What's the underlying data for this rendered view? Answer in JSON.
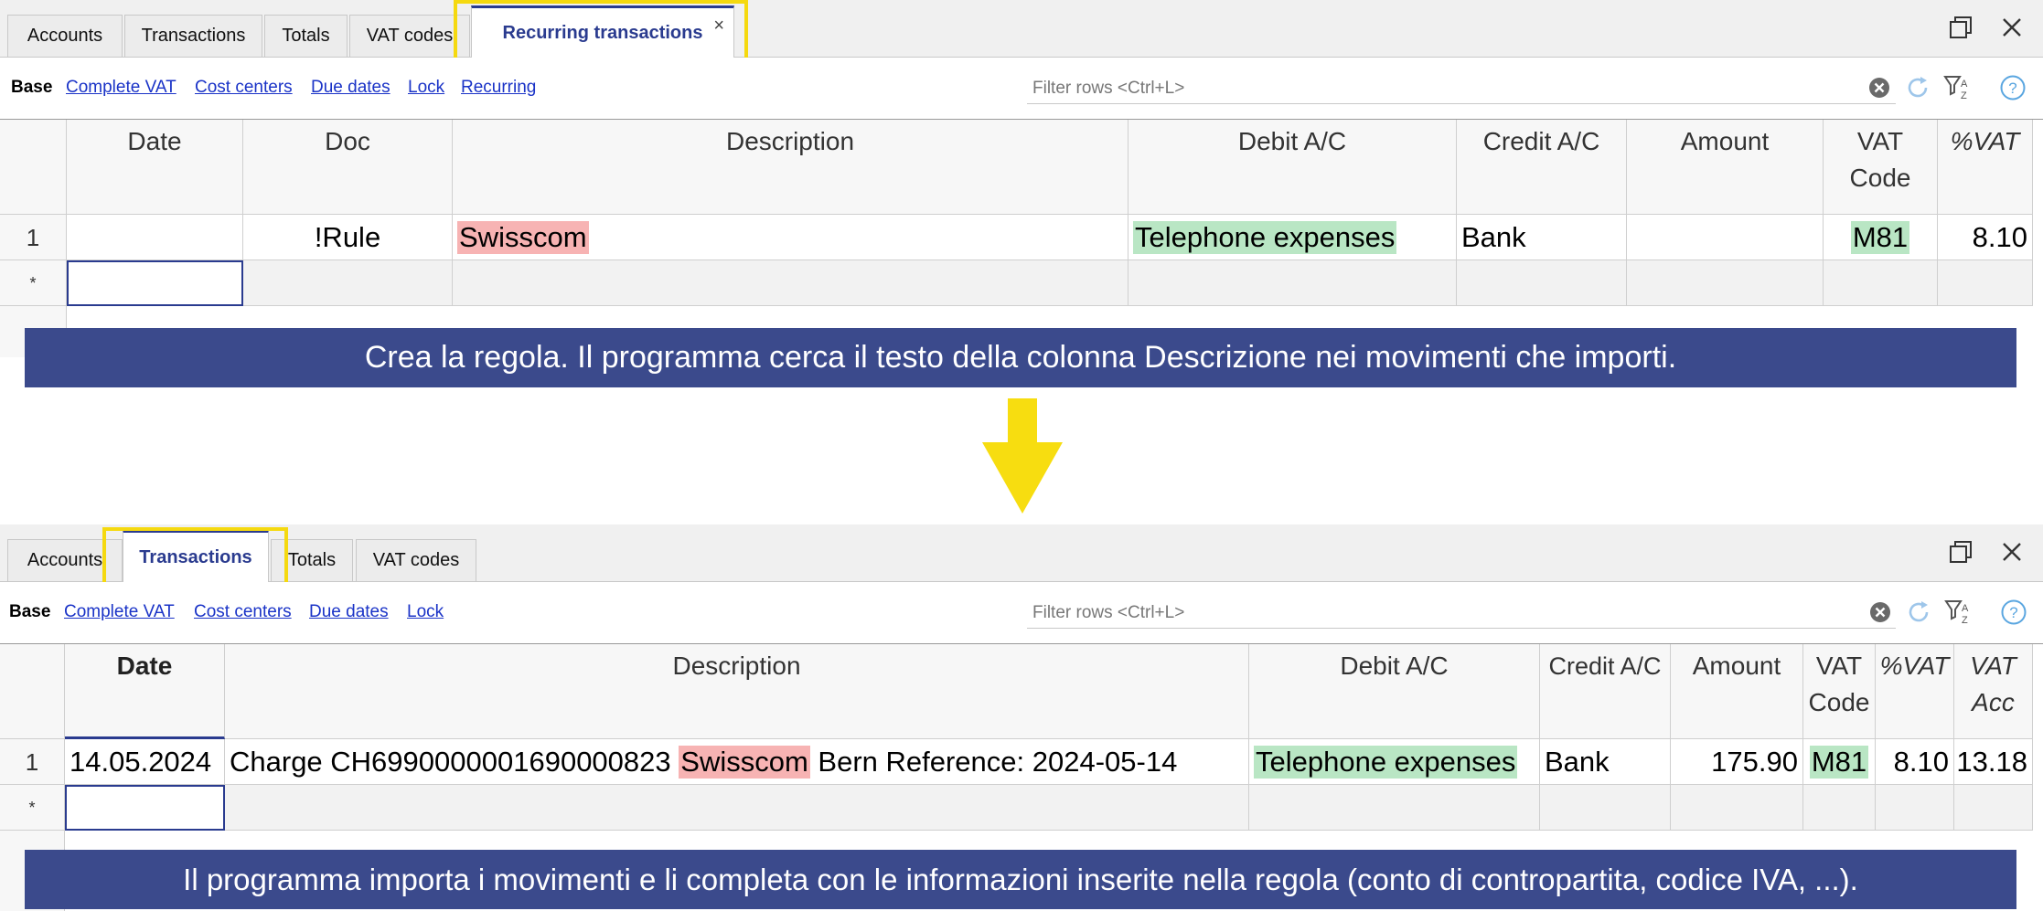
{
  "top": {
    "tabs": [
      "Accounts",
      "Transactions",
      "Totals",
      "VAT codes"
    ],
    "active_tab": "Recurring transactions",
    "tab_close_glyph": "×",
    "views": [
      "Base",
      "Complete VAT",
      "Cost centers",
      "Due dates",
      "Lock",
      "Recurring"
    ],
    "filter_placeholder": "Filter rows <Ctrl+L>",
    "columns": [
      "Date",
      "Doc",
      "Description",
      "Debit A/C",
      "Credit A/C",
      "Amount",
      "VAT Code",
      "%VAT"
    ],
    "row": {
      "num": "1",
      "date": "",
      "doc": "!Rule",
      "description": "Swisscom",
      "debit": "Telephone expenses",
      "credit": "Bank",
      "amount": "",
      "vat_code": "M81",
      "vat_pct": "8.10"
    },
    "new_row_marker": "*"
  },
  "caption_top": "Crea la regola. Il programma cerca il testo della colonna Descrizione nei movimenti che importi.",
  "bottom": {
    "tabs": [
      "Accounts",
      "Totals",
      "VAT codes"
    ],
    "active_tab": "Transactions",
    "views": [
      "Base",
      "Complete VAT",
      "Cost centers",
      "Due dates",
      "Lock"
    ],
    "filter_placeholder": "Filter rows <Ctrl+L>",
    "columns": [
      "Date",
      "Description",
      "Debit A/C",
      "Credit A/C",
      "Amount",
      "VAT Code",
      "%VAT",
      "VAT Acc"
    ],
    "row": {
      "num": "1",
      "date": "14.05.2024",
      "desc_pre": "Charge CH6990000001690000823",
      "desc_hl": "Swisscom",
      "desc_post": "Bern Reference: 2024-05-14",
      "debit": "Telephone expenses",
      "credit": "Bank",
      "amount": "175.90",
      "vat_code": "M81",
      "vat_pct": "8.10",
      "vat_acc": "13.18"
    },
    "new_row_marker": "*"
  },
  "caption_bottom": "Il programma importa i movimenti e li completa con le informazioni inserite nella regola (conto di contropartita, codice IVA, ...).",
  "colors": {
    "accent_navy": "#3b4a8c",
    "highlight_yellow": "#f5d90f",
    "link_blue": "#1a33c7",
    "match_red": "#f7b3b3",
    "match_green": "#b9e6c4"
  },
  "icons": [
    "close-icon",
    "restore-window-icon",
    "clear-filter-icon",
    "refresh-icon",
    "sort-filter-icon",
    "help-icon",
    "down-arrow-icon"
  ]
}
